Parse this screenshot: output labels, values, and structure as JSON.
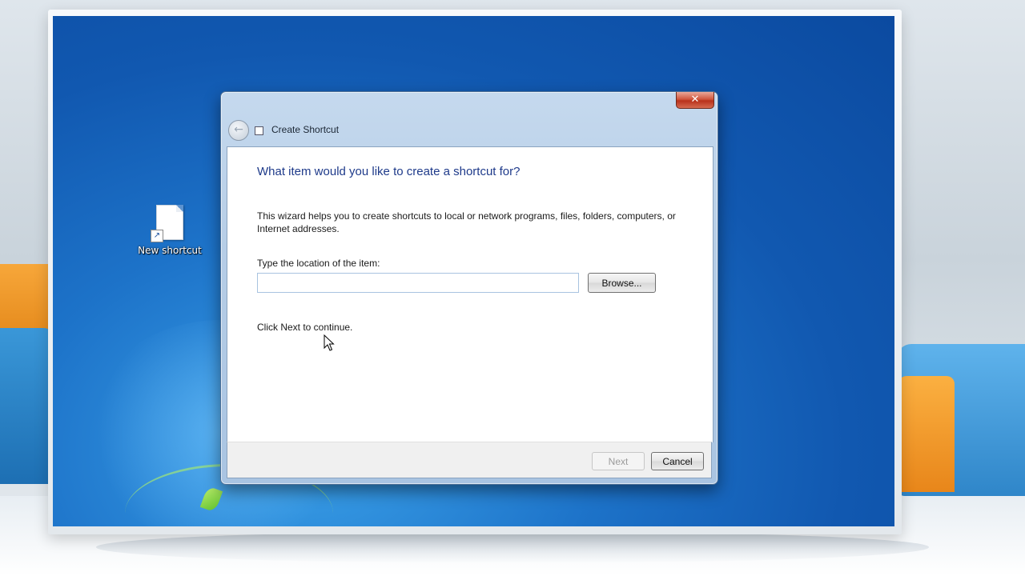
{
  "desktop": {
    "icon_label": "New shortcut"
  },
  "window": {
    "title": "Create Shortcut",
    "close_glyph": "✕",
    "back_glyph": "←"
  },
  "content": {
    "heading": "What item would you like to create a shortcut for?",
    "description": "This wizard helps you to create shortcuts to local or network programs, files, folders, computers, or Internet addresses.",
    "location_label": "Type the location of the item:",
    "location_value": "",
    "browse_label": "Browse...",
    "continue_text": "Click Next to continue."
  },
  "footer": {
    "next_label": "Next",
    "next_enabled": false,
    "cancel_label": "Cancel"
  },
  "colors": {
    "heading": "#1e3a8a",
    "desktop_blue": "#1158b0",
    "close_red": "#c7402a"
  },
  "icons": [
    "new-shortcut-file-icon",
    "shortcut-arrow-icon",
    "back-arrow-icon",
    "close-icon",
    "mouse-cursor-icon"
  ]
}
